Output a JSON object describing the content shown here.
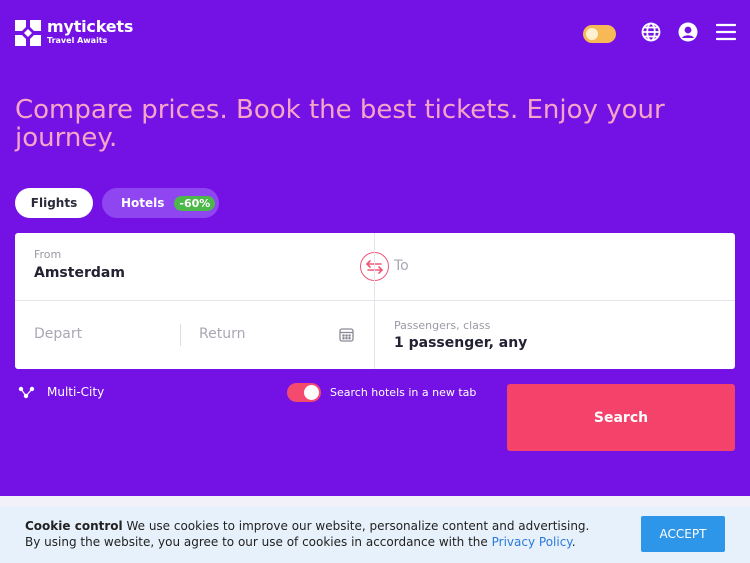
{
  "brand": {
    "name": "mytickets",
    "tagline": "Travel Awaits"
  },
  "header": {
    "icons": [
      "theme-toggle",
      "globe-icon",
      "account-icon",
      "menu-icon"
    ]
  },
  "hero": {
    "headline": "Compare prices. Book the best tickets. Enjoy your journey."
  },
  "tabs": [
    {
      "label": "Flights"
    },
    {
      "label": "Hotels",
      "badge": "-60%"
    }
  ],
  "search_form": {
    "from_label": "From",
    "from_value": "Amsterdam",
    "to_placeholder": "To",
    "depart_placeholder": "Depart",
    "return_placeholder": "Return",
    "passengers_label": "Passengers, class",
    "passengers_value": "1 passenger, any"
  },
  "options": {
    "multi_city_label": "Multi-City",
    "hotels_toggle_label": "Search hotels in a new tab",
    "hotels_toggle_on": true
  },
  "search_button": {
    "label": "Search"
  },
  "cookie": {
    "title": "Cookie control",
    "line1": "We use cookies to improve our website, personalize content and advertising.",
    "line2": "By using the website, you agree to our use of cookies in accordance with the",
    "link": "Privacy Policy",
    "suffix": ".",
    "accept_label": "ACCEPT"
  },
  "colors": {
    "background": "#7412e6",
    "headline": "#f7a5c6",
    "accent": "#f4426a",
    "badge": "#4cb84a",
    "accept": "#2e96e8"
  }
}
